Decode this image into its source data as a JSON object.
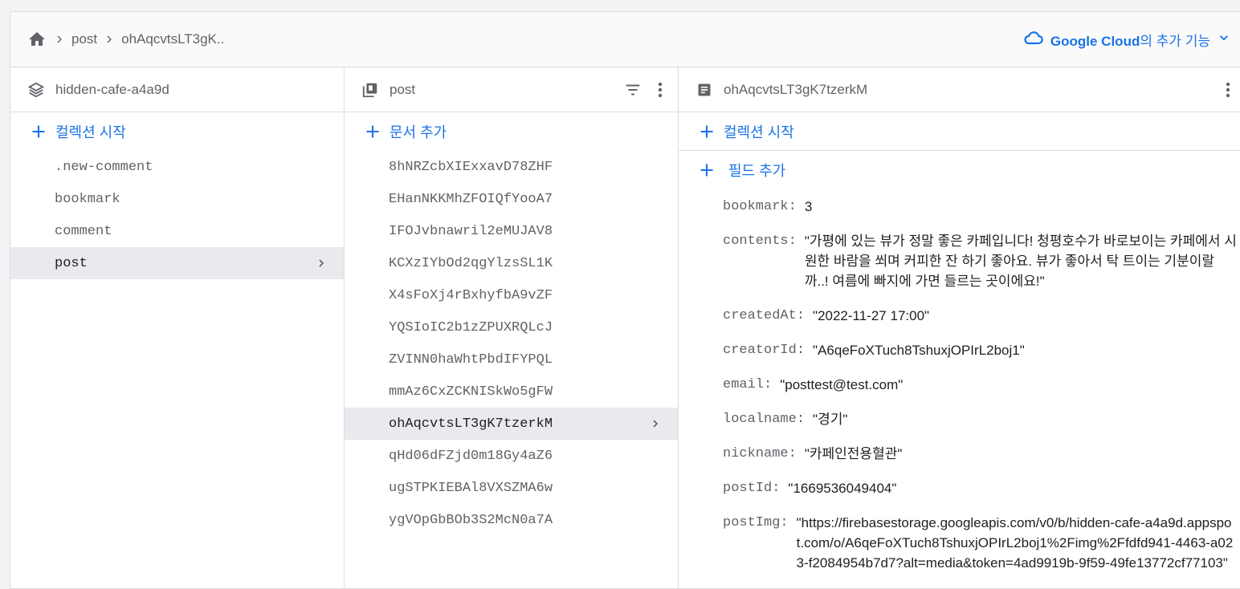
{
  "breadcrumb": {
    "items": [
      "post",
      "ohAqcvtsLT3gK.."
    ]
  },
  "google_cloud": {
    "brand": "Google Cloud",
    "suffix": "의 추가 기능"
  },
  "columns": {
    "root": {
      "title": "hidden-cafe-a4a9d",
      "action": "컬렉션 시작",
      "items": [
        ".new-comment",
        "bookmark",
        "comment",
        "post"
      ],
      "selected_index": 3
    },
    "collection": {
      "title": "post",
      "action": "문서 추가",
      "items": [
        "8hNRZcbXIExxavD78ZHF",
        "EHanNKKMhZFOIQfYooA7",
        "IFOJvbnawril2eMUJAV8",
        "KCXzIYbOd2qgYlzsSL1K",
        "X4sFoXj4rBxhyfbA9vZF",
        "YQSIoIC2b1zZPUXRQLcJ",
        "ZVINN0haWhtPbdIFYPQL",
        "mmAz6CxZCKNISkWo5gFW",
        "ohAqcvtsLT3gK7tzerkM",
        "qHd06dFZjd0m18Gy4aZ6",
        "ugSTPKIEBAl8VXSZMA6w",
        "ygVOpGbBOb3S2McN0a7A"
      ],
      "selected_index": 8
    },
    "document": {
      "title": "ohAqcvtsLT3gK7tzerkM",
      "action_collection": "컬렉션 시작",
      "action_field": "필드 추가",
      "fields": [
        {
          "key": "bookmark:",
          "value": "3"
        },
        {
          "key": "contents:",
          "value": "\"가평에 있는 뷰가 정말 좋은 카페입니다! 청평호수가 바로보이는 카페에서 시원한 바람을 쐬며 커피한 잔 하기 좋아요. 뷰가 좋아서 탁 트이는 기분이랄까..! 여름에 빠지에 가면 들르는 곳이에요!\""
        },
        {
          "key": "createdAt:",
          "value": "\"2022-11-27 17:00\""
        },
        {
          "key": "creatorId:",
          "value": "\"A6qeFoXTuch8TshuxjOPIrL2boj1\""
        },
        {
          "key": "email:",
          "value": "\"posttest@test.com\""
        },
        {
          "key": "localname:",
          "value": "\"경기\""
        },
        {
          "key": "nickname:",
          "value": "\"카페인전용혈관\""
        },
        {
          "key": "postId:",
          "value": "\"1669536049404\""
        },
        {
          "key": "postImg:",
          "value": "\"https://firebasestorage.googleapis.com/v0/b/hidden-cafe-a4a9d.appspot.com/o/A6qeFoXTuch8TshuxjOPIrL2boj1%2Fimg%2Ffdfd941-4463-a023-f2084954b7d7?alt=media&token=4ad9919b-9f59-49fe13772cf77103\""
        }
      ]
    }
  },
  "colors": {
    "accent": "#1a73e8",
    "selected_bg": "#e8eaed",
    "border": "#dadce0"
  }
}
